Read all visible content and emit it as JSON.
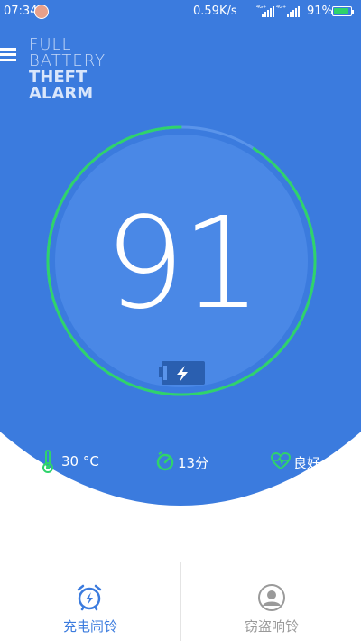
{
  "status_bar": {
    "time": "07:34",
    "net_speed": "0.59K/s",
    "sim1_tag": "4G+",
    "sim2_tag": "4G+",
    "battery_percent": "91%",
    "battery_level": 0.91
  },
  "app": {
    "logo_lines": [
      "FULL",
      "BATTERY",
      "THEFT",
      "ALARM"
    ]
  },
  "battery": {
    "level": 91,
    "level_label": "91"
  },
  "stats": {
    "temperature": "30 °C",
    "time_remaining": "13分",
    "health": "良好"
  },
  "bottom_nav": {
    "items": [
      {
        "label": "充电闹铃",
        "active": true
      },
      {
        "label": "窃盗响铃",
        "active": false
      }
    ]
  },
  "colors": {
    "background": "#3b7bde",
    "disc": "#4a88e6",
    "ring_active": "#2fd36b",
    "ring_track": "#5a94ea",
    "nav_active": "#3b7bde",
    "nav_inactive": "#9a9a9a"
  }
}
